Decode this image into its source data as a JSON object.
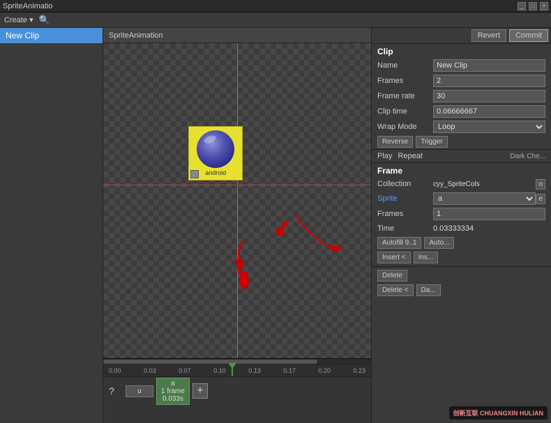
{
  "titlebar": {
    "title": "SpriteAnimatio",
    "close_btn": "×",
    "min_btn": "_",
    "max_btn": "□"
  },
  "toolbar": {
    "create_label": "Create ▾",
    "search_placeholder": "🔍"
  },
  "sidebar": {
    "items": [
      {
        "label": "New Clip",
        "active": true
      }
    ]
  },
  "canvas": {
    "anim_label": "SpriteAnimation"
  },
  "right_panel": {
    "revert_label": "Revert",
    "commit_label": "Commit",
    "clip_section": "Clip",
    "fields": {
      "name_label": "Name",
      "name_value": "New Clip",
      "frames_label": "Frames",
      "frames_value": "2",
      "frame_rate_label": "Frame rate",
      "frame_rate_value": "30",
      "clip_time_label": "Clip time",
      "clip_time_value": "0.06666667",
      "wrap_mode_label": "Wrap Mode",
      "wrap_mode_value": "Loop"
    },
    "buttons": {
      "reverse_label": "Reverse",
      "trigger_label": "Trigger"
    },
    "playback": {
      "play_label": "Play",
      "repeat_label": "Repeat",
      "dark_check_label": "Dark Che..."
    },
    "frame_section": "Frame",
    "frame_fields": {
      "collection_label": "Collection",
      "collection_value": "cyy_SpriteCols",
      "sprite_label": "Sprite",
      "sprite_value": "a",
      "frames_label": "Frames",
      "frames_value": "1",
      "time_label": "Time",
      "time_value": "0.03333334"
    },
    "frame_buttons": {
      "autofill_label": "Autofill 9..1",
      "auto_label": "Auto...",
      "insert_less_label": "Insert <",
      "insert_label": "Ins...",
      "delete_label": "Delete",
      "delete_less_label": "Delete <",
      "da_label": "Da..."
    }
  },
  "timeline": {
    "ruler_marks": [
      "0.00",
      "0.03",
      "0.07",
      "0.10",
      "0.13",
      "0.17",
      "0.20",
      "0.23"
    ],
    "question_mark": "?",
    "track_u_label": "u",
    "track_a_label": "a",
    "track_frames_label": "1 frame",
    "track_time_label": "0.033s",
    "add_frame_label": "+"
  },
  "watermark": {
    "text": "创新互联 CHUANGXIN HULIAN"
  }
}
